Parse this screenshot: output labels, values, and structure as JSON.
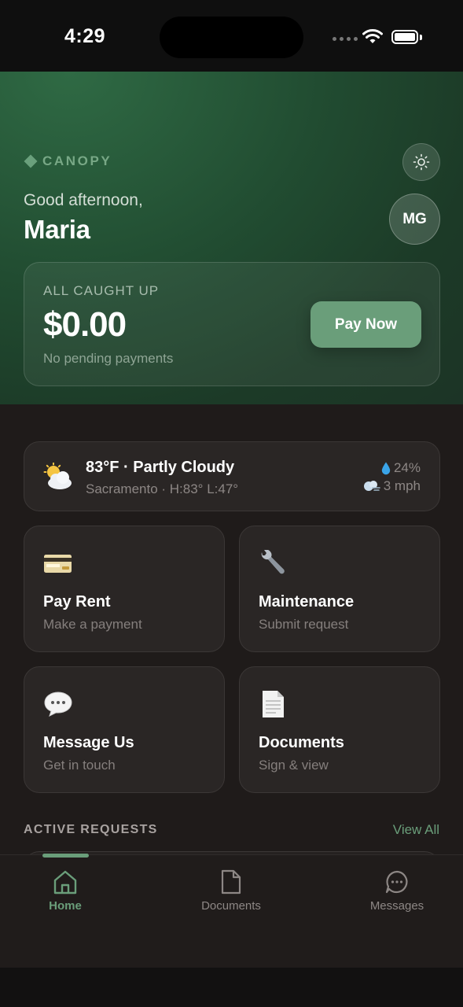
{
  "status_bar": {
    "time": "4:29"
  },
  "header": {
    "brand": "CANOPY",
    "greeting": "Good afternoon,",
    "user_name": "Maria",
    "avatar_initials": "MG",
    "theme_icon": "sun-icon"
  },
  "balance": {
    "label": "ALL CAUGHT UP",
    "amount": "$0.00",
    "subtitle": "No pending payments",
    "pay_button": "Pay Now"
  },
  "weather": {
    "icon": "partly-cloudy-icon",
    "summary": "83°F · Partly Cloudy",
    "details": "Sacramento · H:83° L:47°",
    "humidity": "24%",
    "wind": "3 mph"
  },
  "tiles": [
    {
      "icon": "credit-card-icon",
      "title": "Pay Rent",
      "subtitle": "Make a payment"
    },
    {
      "icon": "wrench-icon",
      "title": "Maintenance",
      "subtitle": "Submit request"
    },
    {
      "icon": "speech-bubble-icon",
      "title": "Message Us",
      "subtitle": "Get in touch"
    },
    {
      "icon": "document-icon",
      "title": "Documents",
      "subtitle": "Sign & view"
    }
  ],
  "active_requests": {
    "title": "ACTIVE REQUESTS",
    "view_all": "View All"
  },
  "tabbar": {
    "tabs": [
      {
        "icon": "home-icon",
        "label": "Home",
        "active": true
      },
      {
        "icon": "document-icon",
        "label": "Documents",
        "active": false
      },
      {
        "icon": "chat-icon",
        "label": "Messages",
        "active": false
      }
    ]
  },
  "colors": {
    "accent": "#6a9e7a",
    "header_green": "#214c31",
    "background": "#1f1b1a",
    "card": "#2a2625"
  }
}
